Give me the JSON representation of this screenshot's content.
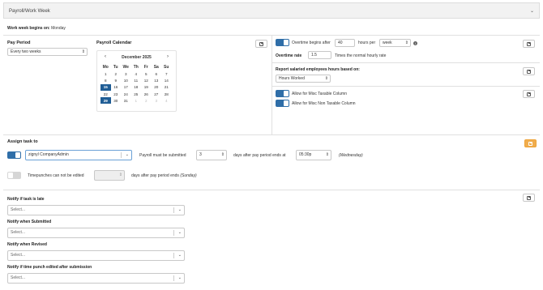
{
  "header": {
    "title": "Payroll/Work Week"
  },
  "week_begins": {
    "label": "Work week begins on:",
    "value": "Monday"
  },
  "pay_period": {
    "label": "Pay Period",
    "value": "Every two weeks"
  },
  "calendar": {
    "label": "Payroll Calendar",
    "month": "December 2025",
    "prev": "‹",
    "next": "›",
    "weekdays": [
      "Mo",
      "Tu",
      "We",
      "Th",
      "Fr",
      "Sa",
      "Su"
    ],
    "weeks": [
      [
        "1",
        "2",
        "3",
        "4",
        "5",
        "6",
        "7"
      ],
      [
        "8",
        "9",
        "10",
        "11",
        "12",
        "13",
        "14"
      ],
      [
        "15",
        "16",
        "17",
        "18",
        "19",
        "20",
        "21"
      ],
      [
        "22",
        "23",
        "24",
        "25",
        "26",
        "27",
        "28"
      ],
      [
        "29",
        "30",
        "31",
        "1",
        "2",
        "3",
        "4"
      ]
    ]
  },
  "overtime": {
    "begins_label": "Overtime begins after",
    "hours": "40",
    "per_label": "hours per",
    "per_value": "week",
    "rate_label": "Overtime rate",
    "rate_value": "1.5",
    "rate_suffix": "Times the normal hourly rate"
  },
  "salaried": {
    "label": "Report salaried employees hours based on:",
    "value": "Hours Worked"
  },
  "misc": {
    "taxable": "Allow for Misc Taxable Column",
    "non_taxable": "Allow for Misc Non Taxable Column"
  },
  "assign": {
    "label": "Assign task to",
    "assignee": "zignyl CompanyAdmin",
    "submit_label": "Payroll must be submitted",
    "days_value": "3",
    "days_after_label": "days after pay period ends at",
    "time_value": "05:30p",
    "weekday": "(Wednesday)"
  },
  "timepunch": {
    "label": "Timepunches can not be edited",
    "days_value": "",
    "after_label": "days after pay period ends",
    "weekday": "(Sunday)"
  },
  "notify": {
    "placeholder": "Select...",
    "late_label": "Notify if task is late",
    "submitted_label": "Notify when Submitted",
    "revised_label": "Notify when Revised",
    "edited_label": "Notify if time punch edited after submission"
  },
  "icons": {
    "info": "i",
    "dropdown": "⌄",
    "chevron": "⌄"
  },
  "colors": {
    "toggle_on": "#2f6ea8",
    "selected_date": "#1f5d95",
    "save_orange": "#f0ad4e"
  }
}
